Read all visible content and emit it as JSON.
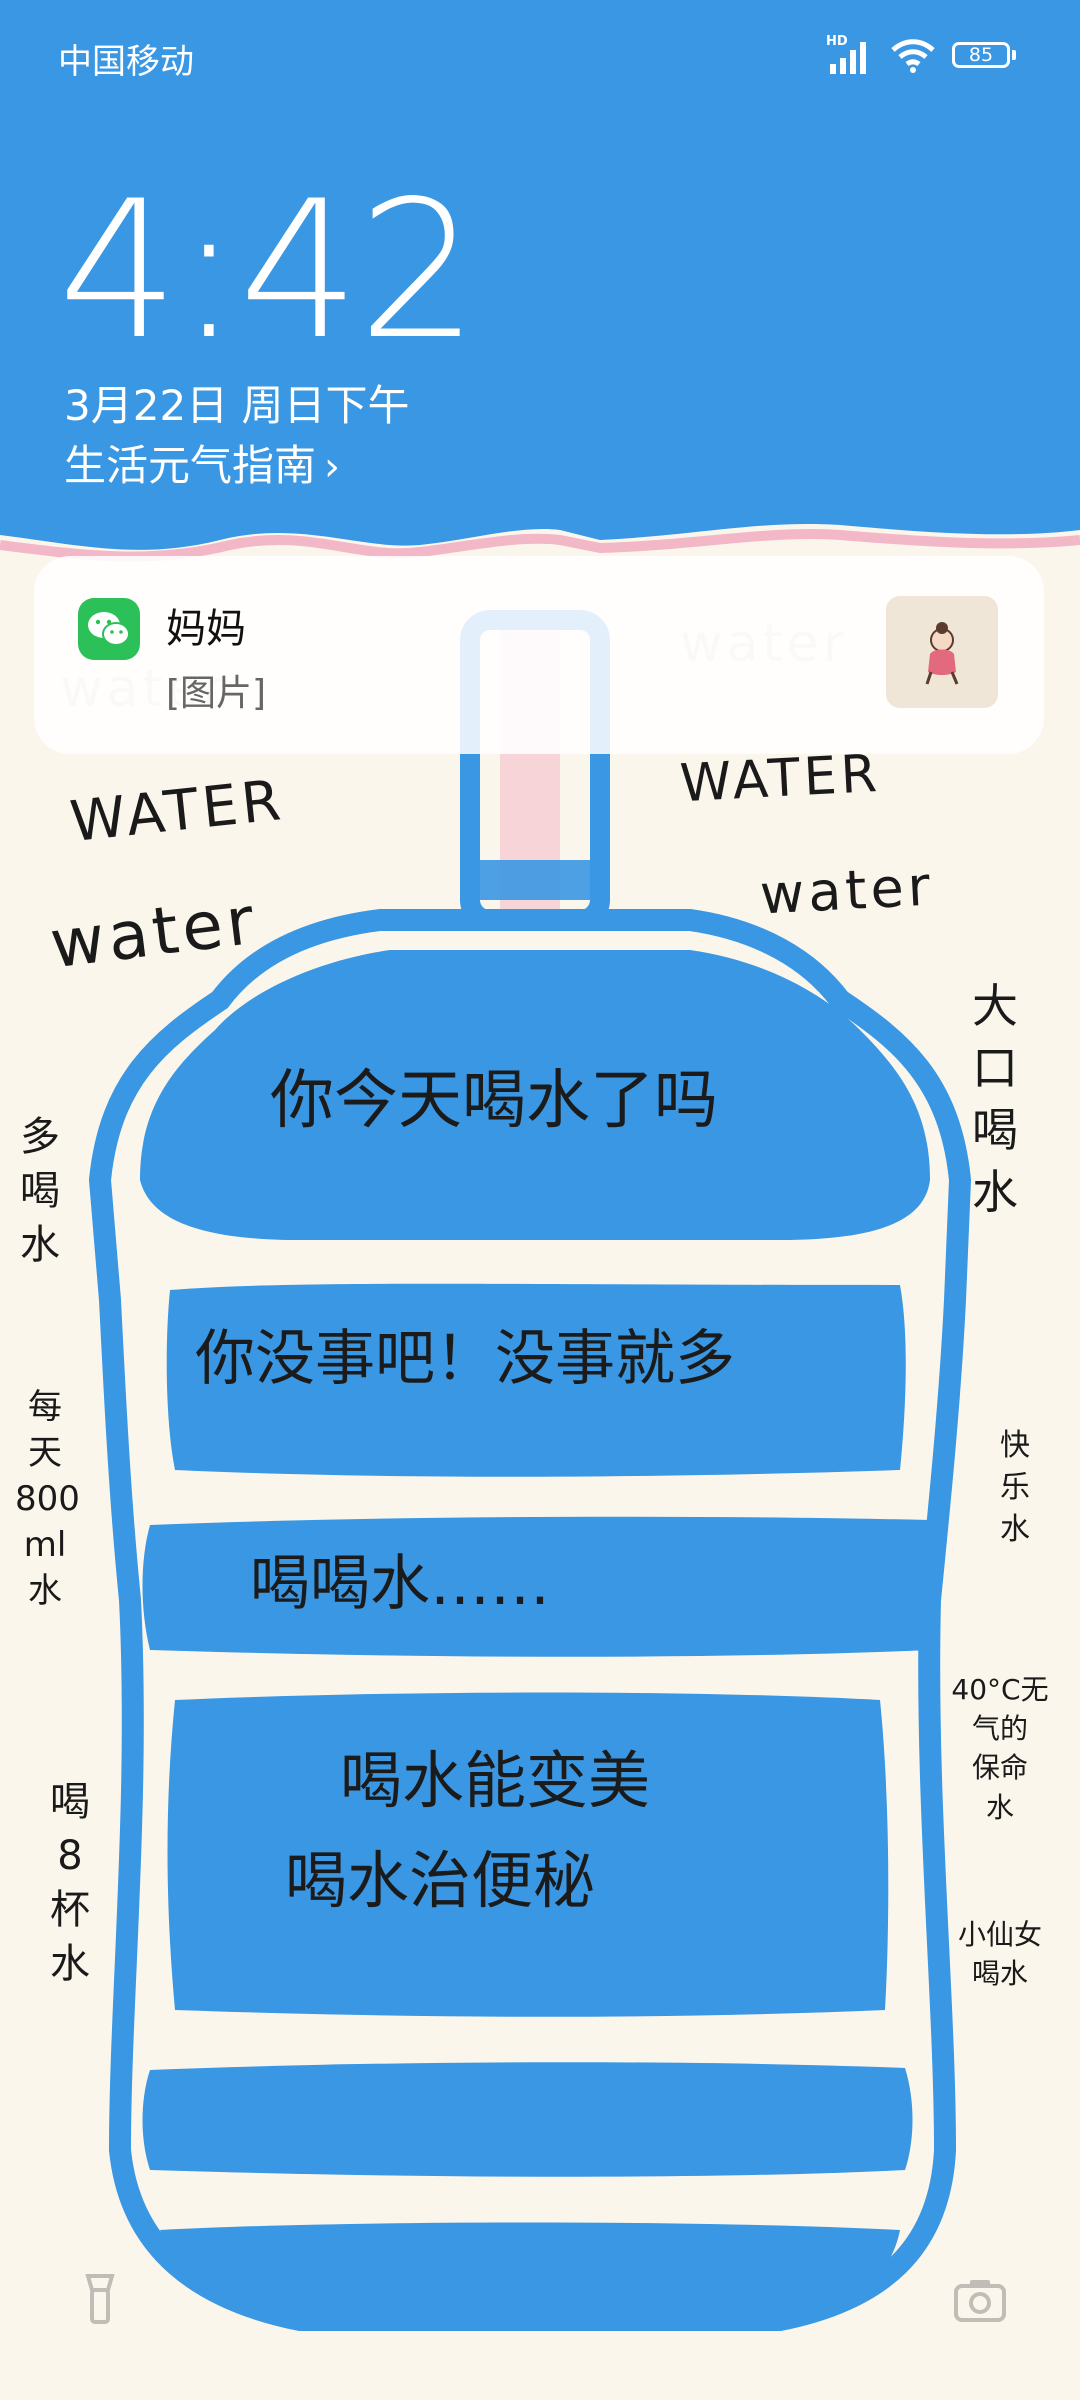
{
  "status_bar": {
    "carrier": "中国移动",
    "network": "HD",
    "battery": "85"
  },
  "lockscreen": {
    "time": "4:42",
    "date": "3月22日 周日下午",
    "guide_link": "生活元气指南",
    "guide_chevron": "›"
  },
  "notification": {
    "app_icon": "wechat-icon",
    "sender": "妈妈",
    "body": "[图片]",
    "thumbnail": "sticker-thumbnail"
  },
  "wallpaper": {
    "words": {
      "water_faded_left": "water",
      "water_faded_right": "water",
      "water_upper_left": "WATER",
      "water_upper_right": "WATER",
      "water_lower_left": "water",
      "water_lower_right": "water"
    },
    "bottle_text": {
      "line1": "你今天喝水了吗",
      "line2": "你没事吧！没事就多",
      "line3": "喝喝水……",
      "line4": "喝水能变美",
      "line5": "喝水治便秘"
    },
    "side_left": {
      "col1": "多\n喝\n水",
      "col2": "每\n天\n800\nml\n水",
      "col3": "喝\n8\n杯\n水"
    },
    "side_right": {
      "col1": "大\n口\n喝\n水",
      "col2": "快\n乐\n水",
      "col3": "40°C无\n气的\n保命\n水",
      "col4": "小仙女\n喝水"
    },
    "colors": {
      "sky_blue": "#3a97e3",
      "bottle_blue": "#3a97e3",
      "pink": "#f2b8c8",
      "paper": "#fbf6ec"
    }
  },
  "bottom_icons": {
    "left": "flashlight-icon",
    "right": "camera-icon"
  }
}
